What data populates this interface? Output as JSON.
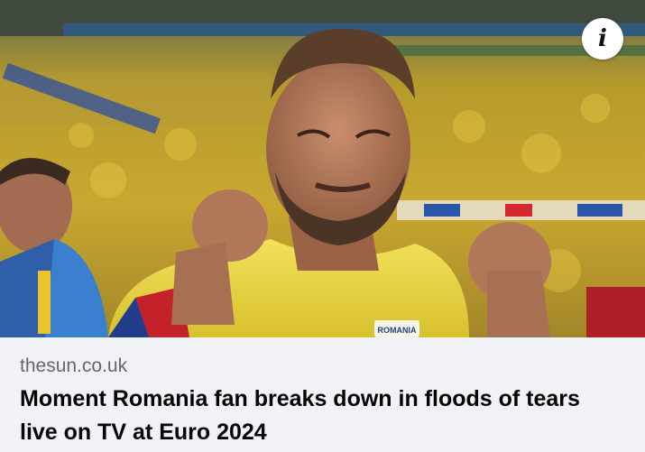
{
  "link_preview": {
    "domain": "thesun.co.uk",
    "headline": "Moment Romania fan breaks down in floods of tears live on TV at Euro 2024",
    "image": {
      "description_icon": "info-icon",
      "jersey_text": "ROMANIA"
    },
    "info_button_label": "i"
  }
}
